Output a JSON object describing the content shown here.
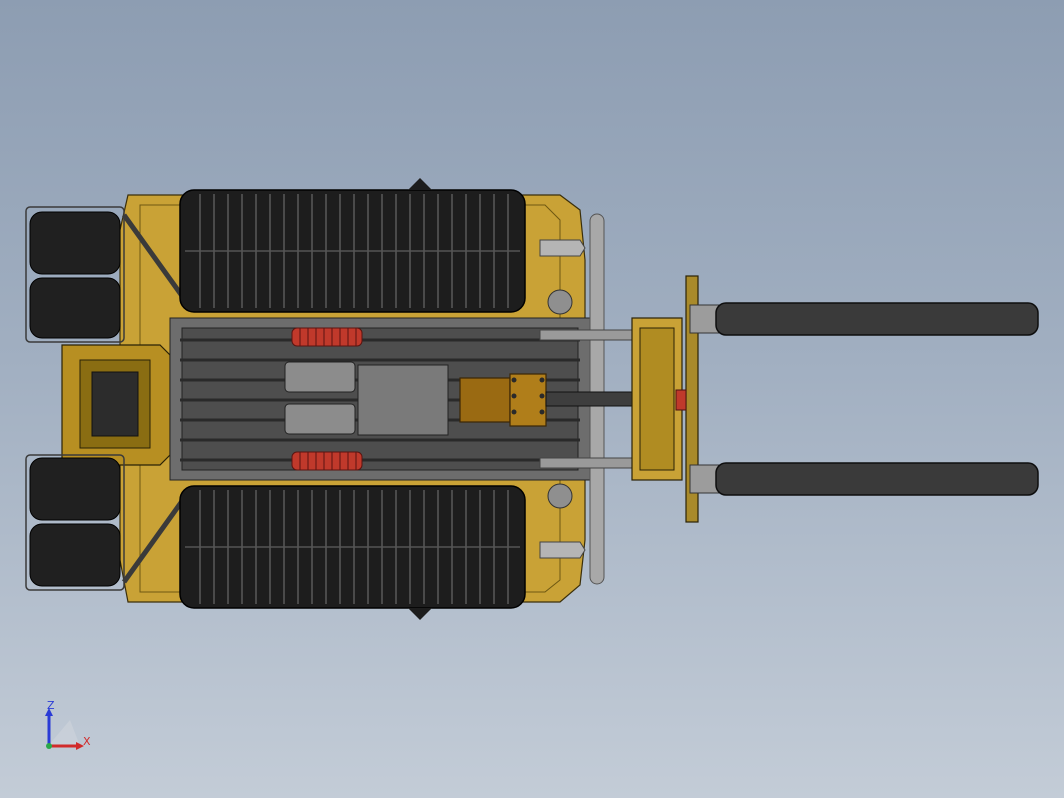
{
  "viewport": {
    "background_top": "#8d9db2",
    "background_bottom": "#c3ccd7"
  },
  "model": {
    "body_color": "#c9a236",
    "body_dark": "#8a6d12",
    "track_color": "#1d1d1d",
    "frame_color": "#5c5c5c",
    "steel_light": "#a8a8a8",
    "fork_color": "#3a3a3a",
    "spring_color": "#c0392b",
    "center_box_color": "#9a6a12"
  },
  "triad": {
    "z_label": "Z",
    "x_label": "X",
    "z_color": "#2a3bd6",
    "x_color": "#d12b2b",
    "y_color": "#2aa84a"
  }
}
